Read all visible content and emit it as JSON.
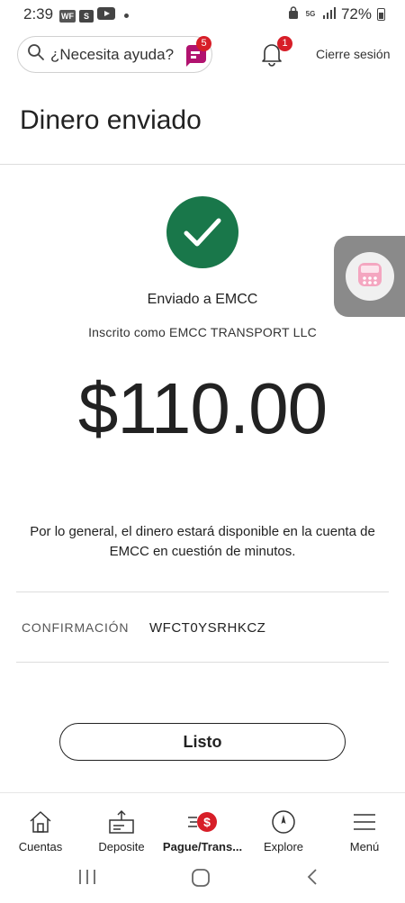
{
  "status_bar": {
    "time": "2:39",
    "app_icons": [
      "WF",
      "S"
    ],
    "network": "5G",
    "battery": "72%"
  },
  "header": {
    "search_placeholder": "¿Necesita ayuda?",
    "chat_badge": "5",
    "notifications_badge": "1",
    "signout_label": "Cierre sesión"
  },
  "page": {
    "title": "Dinero enviado"
  },
  "confirmation": {
    "sent_to": "Enviado a EMCC",
    "enrolled_as": "Inscrito como EMCC TRANSPORT LLC",
    "amount": "$110.00",
    "note": "Por lo general, el dinero estará disponible en la cuenta de EMCC en cuestión de minutos.",
    "confirmation_label": "CONFIRMACIÓN",
    "confirmation_code": "WFCT0YSRHKCZ",
    "done_label": "Listo"
  },
  "colors": {
    "success_green": "#19774a",
    "brand_red": "#d71e28",
    "chat_purple": "#b1126f"
  },
  "bottom_nav": {
    "items": [
      {
        "label": "Cuentas",
        "icon": "home-icon"
      },
      {
        "label": "Deposite",
        "icon": "deposit-icon"
      },
      {
        "label": "Pague/Trans...",
        "icon": "pay-transfer-icon",
        "active": true
      },
      {
        "label": "Explore",
        "icon": "compass-icon"
      },
      {
        "label": "Menú",
        "icon": "hamburger-menu-icon"
      }
    ]
  },
  "system_nav": [
    "recents-button",
    "home-button",
    "back-button"
  ]
}
